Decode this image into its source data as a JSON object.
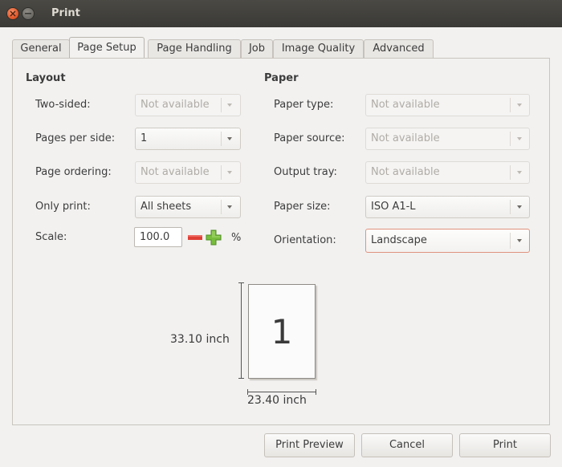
{
  "window": {
    "title": "Print"
  },
  "tabs": [
    {
      "label": "General"
    },
    {
      "label": "Page Setup"
    },
    {
      "label": "Page Handling"
    },
    {
      "label": "Job"
    },
    {
      "label": "Image Quality"
    },
    {
      "label": "Advanced"
    }
  ],
  "active_tab": "Page Setup",
  "layout": {
    "title": "Layout",
    "two_sided": {
      "label": "Two-sided:",
      "value": "Not available"
    },
    "pages_per_side": {
      "label": "Pages per side:",
      "value": "1"
    },
    "page_ordering": {
      "label": "Page ordering:",
      "value": "Not available"
    },
    "only_print": {
      "label": "Only print:",
      "value": "All sheets"
    },
    "scale": {
      "label": "Scale:",
      "value": "100.0",
      "unit": "%"
    }
  },
  "paper": {
    "title": "Paper",
    "paper_type": {
      "label": "Paper type:",
      "value": "Not available"
    },
    "paper_source": {
      "label": "Paper source:",
      "value": "Not available"
    },
    "output_tray": {
      "label": "Output tray:",
      "value": "Not available"
    },
    "paper_size": {
      "label": "Paper size:",
      "value": "ISO A1-L"
    },
    "orientation": {
      "label": "Orientation:",
      "value": "Landscape"
    }
  },
  "preview": {
    "page_number": "1",
    "height_label": "33.10 inch",
    "width_label": "23.40 inch"
  },
  "buttons": {
    "print_preview": "Print Preview",
    "cancel": "Cancel",
    "print": "Print"
  },
  "icons": [
    "close-icon",
    "minimize-icon",
    "minus-icon",
    "plus-icon",
    "dropdown-arrow-icon"
  ],
  "colors": {
    "titlebar": "#3c3b37",
    "close_button": "#e2592c",
    "window_bg": "#f2f1f0",
    "minus_red": "#df3f36",
    "plus_green": "#79bd3d",
    "focus_border": "#e0927d"
  }
}
